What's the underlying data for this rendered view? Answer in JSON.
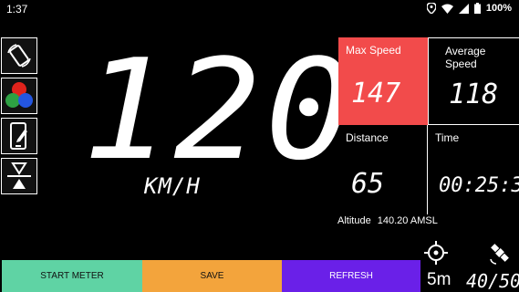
{
  "status": {
    "time": "1:37",
    "battery": "100%"
  },
  "speed": {
    "value": "120",
    "unit": "KM/H"
  },
  "panels": {
    "max_speed": {
      "label": "Max Speed",
      "value": "147"
    },
    "average_speed": {
      "label": "Average Speed",
      "value": "118"
    },
    "distance": {
      "label": "Distance",
      "value": "65"
    },
    "time": {
      "label": "Time",
      "value": "00:25:3"
    }
  },
  "altitude": {
    "label": "Altitude",
    "value": "140.20 AMSL"
  },
  "buttons": {
    "start": "START METER",
    "save": "SAVE",
    "refresh": "REFRESH"
  },
  "gps": {
    "accuracy": "5m",
    "satellites": "40/50"
  },
  "colors": {
    "max_speed_bg": "#f24b4b",
    "start_bg": "#5fd3a4",
    "save_bg": "#f3a43c",
    "refresh_bg": "#6a20e8"
  }
}
